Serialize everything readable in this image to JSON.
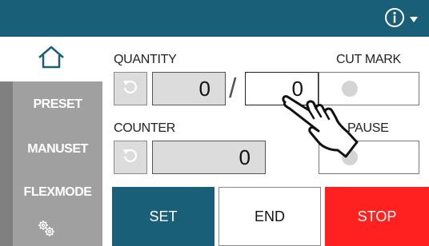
{
  "header": {
    "info_icon": "info-circle-icon",
    "dropdown_icon": "triangle-down-icon",
    "color": "#1a5f78"
  },
  "sidebar": {
    "home_icon": "home-icon",
    "items": [
      {
        "label": "PRESET"
      },
      {
        "label": "MANUSET"
      },
      {
        "label": "FLEXMODE"
      }
    ],
    "settings_icon": "gears-icon"
  },
  "quantity": {
    "label": "QUANTITY",
    "current": "0",
    "target": "0",
    "separator": "/"
  },
  "cut_mark": {
    "label": "CUT MARK"
  },
  "counter": {
    "label": "COUNTER",
    "value": "0"
  },
  "pause": {
    "label": "PAUSE"
  },
  "actions": {
    "set": "SET",
    "end": "END",
    "stop": "STOP"
  },
  "colors": {
    "accent": "#1a5f78",
    "stop": "#ff2020",
    "field": "#dcdcdc"
  }
}
